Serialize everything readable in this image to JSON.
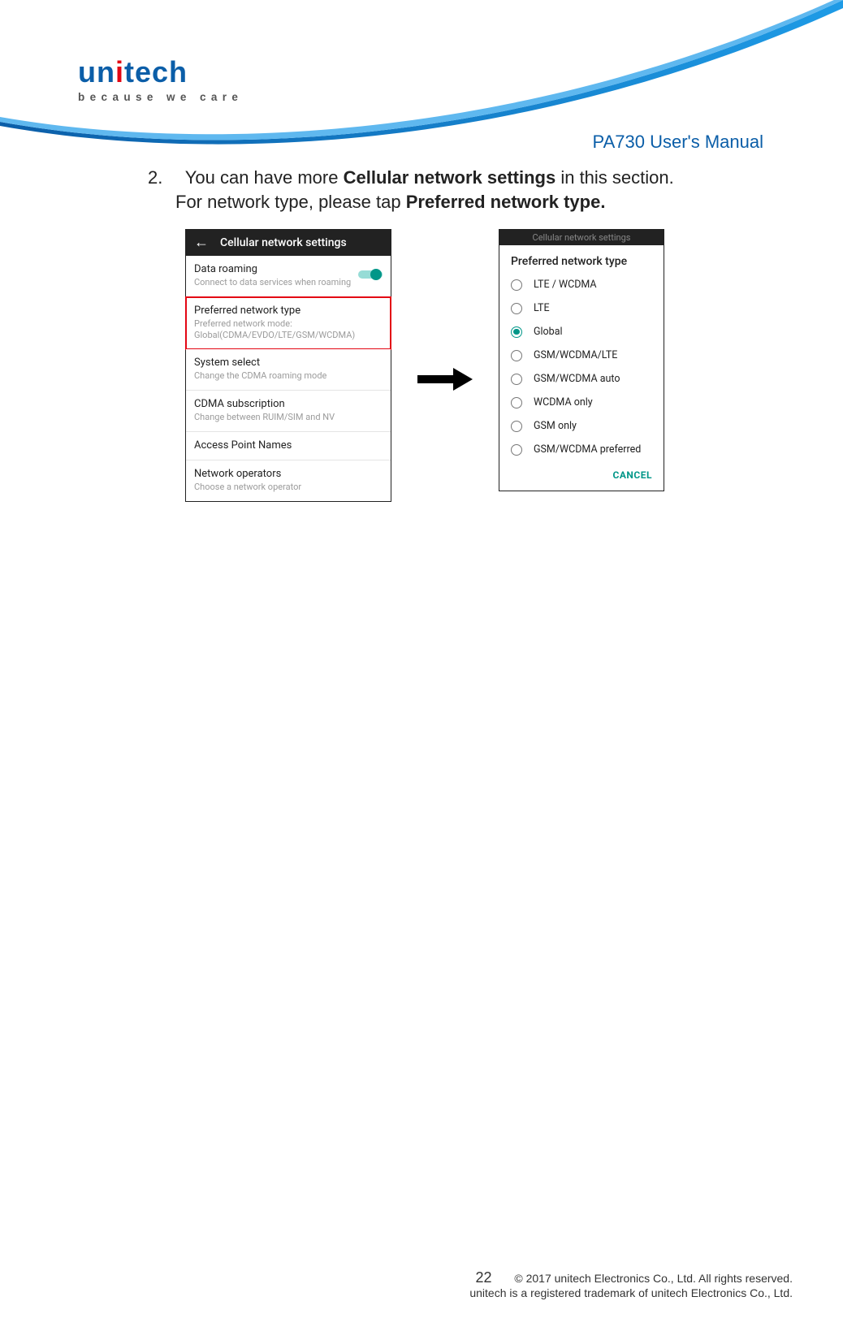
{
  "header": {
    "brand_prefix": "un",
    "brand_dotchar": "i",
    "brand_suffix": "tech",
    "tagline": "because we care",
    "doc_title": "PA730 User's Manual"
  },
  "instruction": {
    "num": "2.",
    "text_1a": "You can have more ",
    "text_1b_bold": "Cellular network settings",
    "text_1c": " in this section.",
    "text_2a": "For network type, please tap ",
    "text_2b_bold": "Preferred network type."
  },
  "screenshot1": {
    "title": "Cellular network settings",
    "rows": [
      {
        "title": "Data roaming",
        "sub": "Connect to data services when roaming",
        "toggle": true
      },
      {
        "title": "Preferred network type",
        "sub": "Preferred network mode: Global(CDMA/EVDO/LTE/GSM/WCDMA)",
        "highlight": true
      },
      {
        "title": "System select",
        "sub": "Change the CDMA roaming mode"
      },
      {
        "title": "CDMA subscription",
        "sub": "Change between RUIM/SIM and NV"
      },
      {
        "title": "Access Point Names"
      },
      {
        "title": "Network operators",
        "sub": "Choose a network operator"
      }
    ]
  },
  "screenshot2": {
    "topstrip": "Cellular network settings",
    "dialog_title": "Preferred network type",
    "options": [
      {
        "label": "LTE / WCDMA",
        "selected": false
      },
      {
        "label": "LTE",
        "selected": false
      },
      {
        "label": "Global",
        "selected": true
      },
      {
        "label": "GSM/WCDMA/LTE",
        "selected": false
      },
      {
        "label": "GSM/WCDMA auto",
        "selected": false
      },
      {
        "label": "WCDMA only",
        "selected": false
      },
      {
        "label": "GSM only",
        "selected": false
      },
      {
        "label": "GSM/WCDMA preferred",
        "selected": false
      }
    ],
    "cancel": "CANCEL"
  },
  "footer": {
    "page": "22",
    "line1": "© 2017 unitech Electronics Co., Ltd. All rights reserved.",
    "line2": "unitech is a registered trademark of unitech Electronics Co., Ltd."
  }
}
